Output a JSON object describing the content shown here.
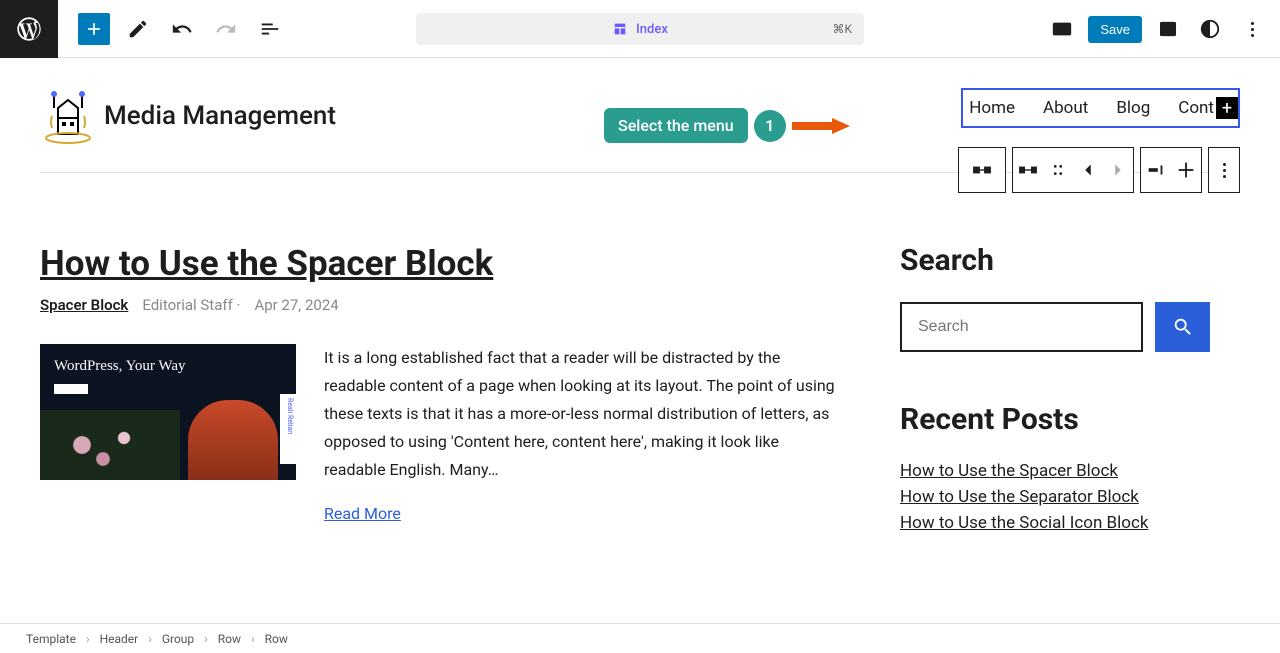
{
  "topbar": {
    "template_name": "Index",
    "shortcut": "⌘K",
    "save_label": "Save"
  },
  "site": {
    "title": "Media Management"
  },
  "annotation": {
    "label": "Select the menu",
    "number": "1"
  },
  "nav": {
    "items": [
      "Home",
      "About",
      "Blog",
      "Cont"
    ]
  },
  "post": {
    "title": "How to Use the Spacer Block",
    "category": "Spacer Block",
    "author": "Editorial Staff",
    "date": "Apr 27, 2024",
    "thumb_heading": "WordPress, Your Way",
    "excerpt": "It is a long established fact that a reader will be distracted by the readable content of a page when looking at its layout. The point of using these texts is that it has a more-or-less normal distribution of letters, as opposed to using 'Content here, content here', making it look like readable English. Many…",
    "read_more": "Read More"
  },
  "sidebar": {
    "search_title": "Search",
    "search_placeholder": "Search",
    "recent_title": "Recent Posts",
    "recent_posts": [
      "How to Use the Spacer Block",
      "How to Use the Separator Block",
      "How to Use the Social Icon Block"
    ]
  },
  "breadcrumb": {
    "items": [
      "Template",
      "Header",
      "Group",
      "Row",
      "Row"
    ]
  }
}
